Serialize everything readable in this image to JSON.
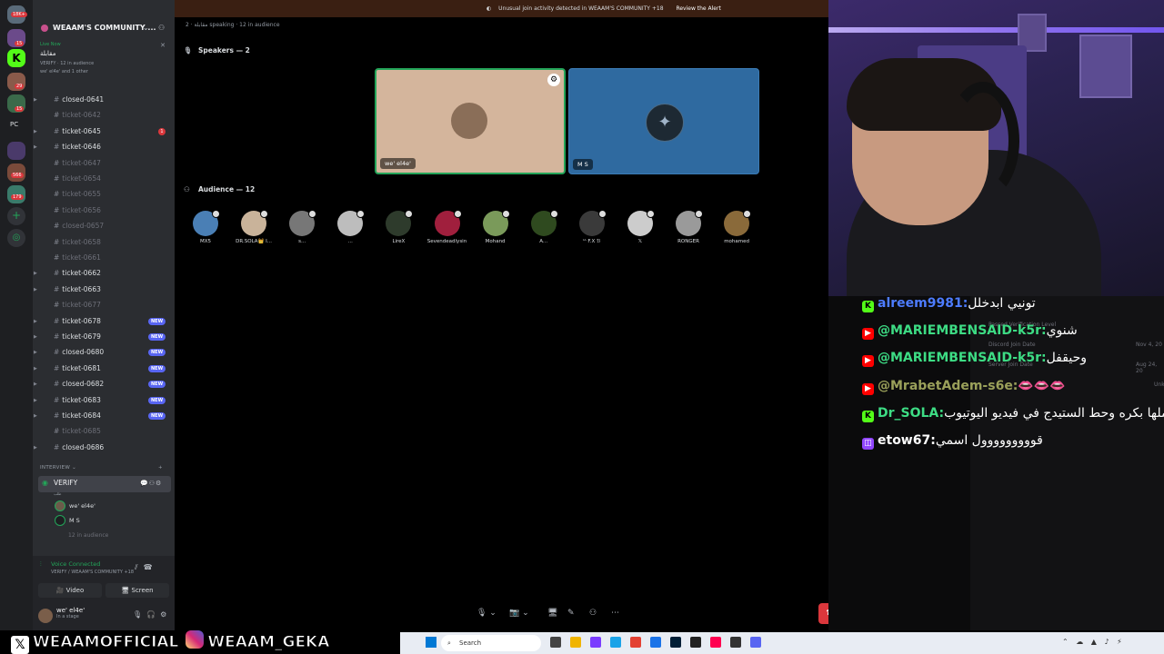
{
  "server": {
    "name": "WEAAM'S COMMUNITY ...",
    "live_label": "Live Now",
    "live_stage": "مقابلة",
    "live_meta": "VERIFY · 12 in audience",
    "live_users": "we' el4e' and 1 other",
    "rail_badges": [
      "18K+",
      "15",
      "29",
      "15",
      "566",
      "179"
    ],
    "rail_label": "PC"
  },
  "channels": [
    {
      "name": "closed-0641",
      "state": "bright",
      "arrow": true
    },
    {
      "name": "ticket-0642",
      "state": "dim",
      "arrow": false
    },
    {
      "name": "ticket-0645",
      "state": "bright",
      "arrow": true,
      "badge": "1"
    },
    {
      "name": "ticket-0646",
      "state": "bright",
      "arrow": true
    },
    {
      "name": "ticket-0647",
      "state": "dim",
      "arrow": false
    },
    {
      "name": "ticket-0654",
      "state": "dim",
      "arrow": false
    },
    {
      "name": "ticket-0655",
      "state": "dim",
      "arrow": false
    },
    {
      "name": "ticket-0656",
      "state": "dim",
      "arrow": false
    },
    {
      "name": "closed-0657",
      "state": "dim",
      "arrow": false
    },
    {
      "name": "ticket-0658",
      "state": "dim",
      "arrow": false
    },
    {
      "name": "ticket-0661",
      "state": "dim",
      "arrow": false
    },
    {
      "name": "ticket-0662",
      "state": "bright",
      "arrow": true
    },
    {
      "name": "ticket-0663",
      "state": "bright",
      "arrow": true
    },
    {
      "name": "ticket-0677",
      "state": "dim",
      "arrow": false
    },
    {
      "name": "ticket-0678",
      "state": "bright",
      "arrow": true,
      "new": "NEW"
    },
    {
      "name": "ticket-0679",
      "state": "bright",
      "arrow": true,
      "new": "NEW"
    },
    {
      "name": "closed-0680",
      "state": "bright",
      "arrow": true,
      "new": "NEW"
    },
    {
      "name": "ticket-0681",
      "state": "bright",
      "arrow": true,
      "new": "NEW"
    },
    {
      "name": "closed-0682",
      "state": "bright",
      "arrow": true,
      "new": "NEW"
    },
    {
      "name": "ticket-0683",
      "state": "bright",
      "arrow": true,
      "new": "NEW"
    },
    {
      "name": "ticket-0684",
      "state": "bright",
      "arrow": true,
      "new": "NEW"
    },
    {
      "name": "ticket-0685",
      "state": "dim",
      "arrow": false
    },
    {
      "name": "closed-0686",
      "state": "bright",
      "arrow": true
    }
  ],
  "category": "INTERVIEW",
  "voice_channel": {
    "name": "VERIFY",
    "sub": "طلب",
    "users": [
      "we' el4e'",
      "M S"
    ],
    "audience": "12 in audience"
  },
  "user_panel": {
    "voice_connected": "Voice Connected",
    "voice_sub": "VERIFY / WEAAM'S COMMUNITY +18",
    "video": "Video",
    "screen": "Screen",
    "username": "we' el4e'",
    "status": "In a stage"
  },
  "main": {
    "alert_text": "Unusual join activity detected in WEAAM'S COMMUNITY +18",
    "alert_action": "Review the Alert",
    "topbar": "مقابلة  ·  2 speaking  ·  12 in audience",
    "speakers_header": "Speakers — 2",
    "audience_header": "Audience — 12",
    "speakers": [
      {
        "name": "we' el4e'"
      },
      {
        "name": "M S"
      }
    ],
    "audience": [
      {
        "name": "MX5",
        "color": "#4a7fb5"
      },
      {
        "name": "DR.SOLA👑 I...",
        "color": "#c9b39a"
      },
      {
        "name": "s...",
        "color": "#777777"
      },
      {
        "name": "...",
        "color": "#bdbdbd"
      },
      {
        "name": "LireX",
        "color": "#2e3b2c"
      },
      {
        "name": "Sevendeadlysin",
        "color": "#a01f3d"
      },
      {
        "name": "Mohand",
        "color": "#7a9a5a"
      },
      {
        "name": "A...",
        "color": "#2f4a1f"
      },
      {
        "name": "ᴵᴬ F.X ℬ",
        "color": "#3a3a3a"
      },
      {
        "name": "𝕏",
        "color": "#cccccc"
      },
      {
        "name": "RONGER",
        "color": "#9a9a9a"
      },
      {
        "name": "mohamed",
        "color": "#8a6a3a"
      }
    ]
  },
  "chat": [
    {
      "platform": "kick",
      "user": "alreem9981:",
      "text": "تونيي ابدخلل",
      "color": "#4d7cff"
    },
    {
      "platform": "yt",
      "user": "@MARIEMBENSAID-k5r:",
      "text": "شنوي",
      "color": "#3ddc84"
    },
    {
      "platform": "yt",
      "user": "@MARIEMBENSAID-k5r:",
      "text": "وحيقفل",
      "color": "#3ddc84"
    },
    {
      "platform": "yt",
      "user": "@MrabetAdem-s6e:",
      "text": "👄👄👄",
      "color": "#9aa05a"
    },
    {
      "platform": "kick",
      "user": "Dr_SOLA:",
      "text": "ب اعملها بكره وحط الستيدج في فيديو اليوتيوب",
      "color": "#3ddc84"
    },
    {
      "platform": "tw",
      "user": "etow67:",
      "text": "قووووووووول اسمي",
      "color": "#ffffff"
    }
  ],
  "chat_ghost": [
    "Passed Verification Level",
    "Discord Join Date",
    "Server Join Date",
    "Nov 4, 20",
    "Aug 24, 20",
    "Unknov"
  ],
  "social": {
    "x_handle": "WEAAMOFFICIAL",
    "ig_handle": "WEAAM_GEKA"
  },
  "taskbar": {
    "search": "Search"
  },
  "colors": {
    "accent": "#5865f2",
    "danger": "#da373c",
    "online": "#23a559"
  }
}
